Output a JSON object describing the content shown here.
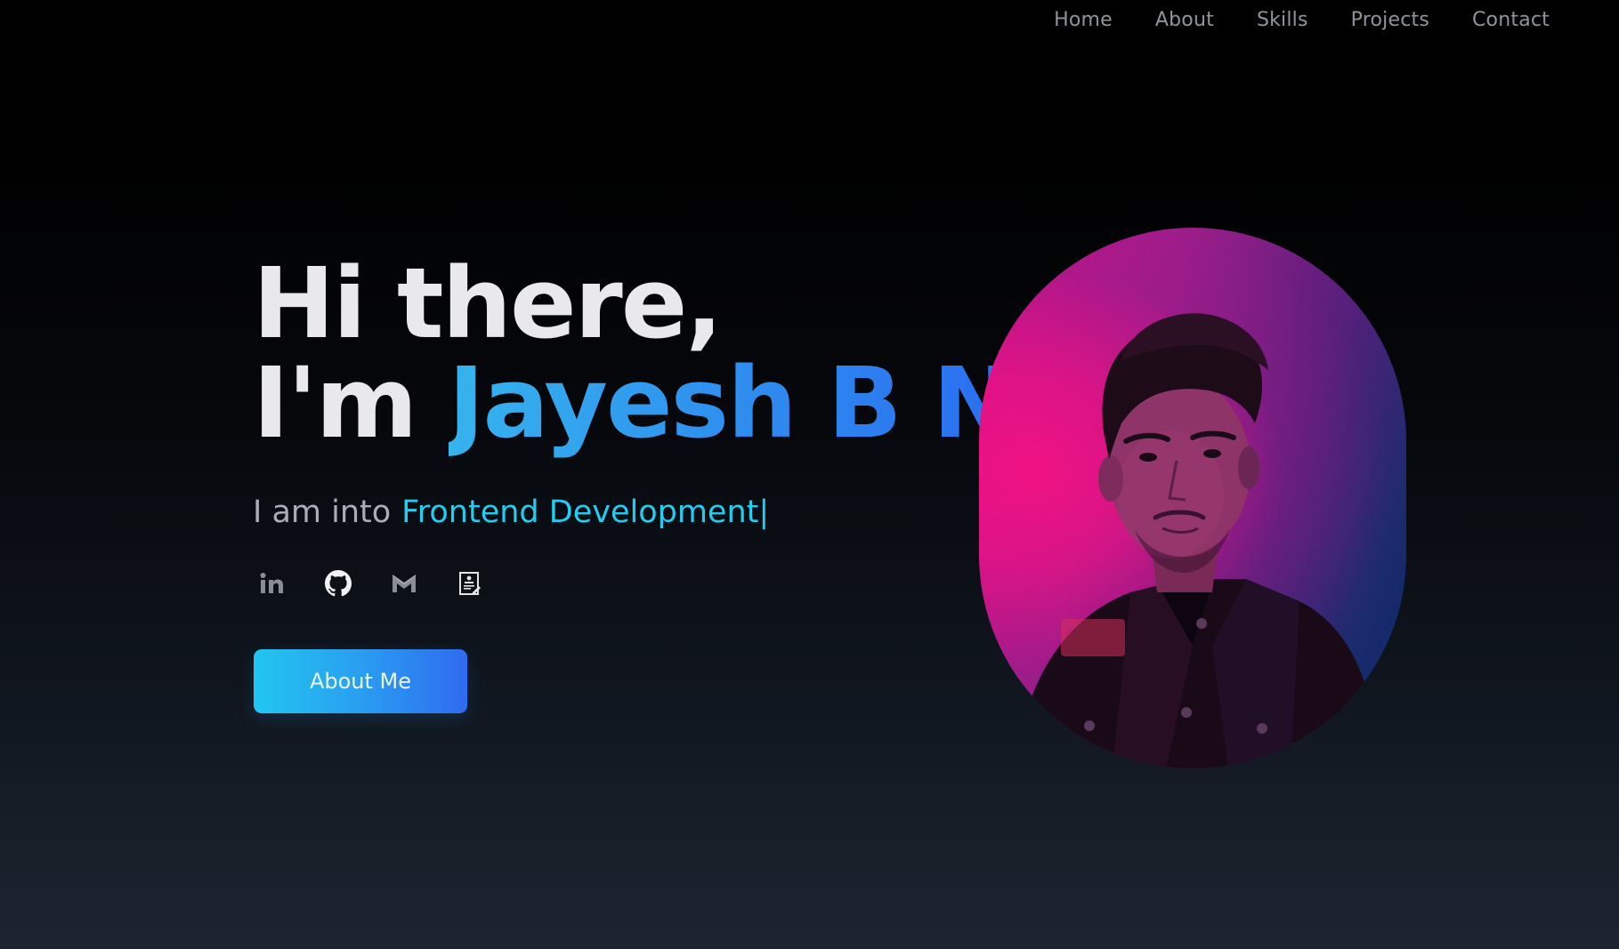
{
  "nav": {
    "items": [
      {
        "label": "Home"
      },
      {
        "label": "About"
      },
      {
        "label": "Skills"
      },
      {
        "label": "Projects"
      },
      {
        "label": "Contact"
      }
    ]
  },
  "hero": {
    "greeting": "Hi there,",
    "intro": "I'm",
    "name": "Jayesh B N",
    "subline_prefix": "I am into",
    "role": "Frontend Development",
    "cursor": "|"
  },
  "socials": [
    {
      "icon": "linkedin-icon"
    },
    {
      "icon": "github-icon"
    },
    {
      "icon": "gmail-icon"
    },
    {
      "icon": "resume-icon"
    }
  ],
  "cta": {
    "label": "About Me"
  },
  "colors": {
    "accent_start": "#22c6f0",
    "accent_end": "#2f6bf0",
    "role_text": "#22cdee",
    "name_gradient_start": "#35b4ee",
    "name_gradient_end": "#2a6df0"
  }
}
